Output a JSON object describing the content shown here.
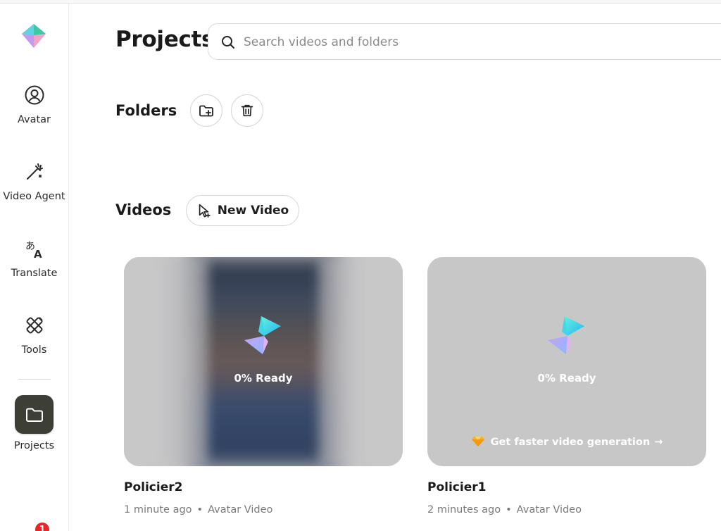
{
  "sidebar": {
    "items": [
      {
        "label": "Avatar",
        "icon": "user-circle-icon"
      },
      {
        "label": "Video Agent",
        "icon": "magic-wand-icon"
      },
      {
        "label": "Translate",
        "icon": "translate-icon"
      },
      {
        "label": "Tools",
        "icon": "tools-icon"
      },
      {
        "label": "Projects",
        "icon": "folder-icon",
        "active": true
      }
    ],
    "notification_count": "1"
  },
  "header": {
    "title": "Projects",
    "search_placeholder": "Search videos and folders"
  },
  "folders": {
    "title": "Folders"
  },
  "videos": {
    "title": "Videos",
    "new_video_label": "New Video",
    "items": [
      {
        "title": "Policier2",
        "status": "0% Ready",
        "time": "1 minute ago",
        "type": "Avatar Video",
        "upsell": ""
      },
      {
        "title": "Policier1",
        "status": "0% Ready",
        "time": "2 minutes ago",
        "type": "Avatar Video",
        "upsell": "Get faster video generation"
      }
    ]
  },
  "colors": {
    "active_tile": "#3d3f36",
    "card_bg": "#c7c7c8",
    "badge": "#e5262b"
  }
}
